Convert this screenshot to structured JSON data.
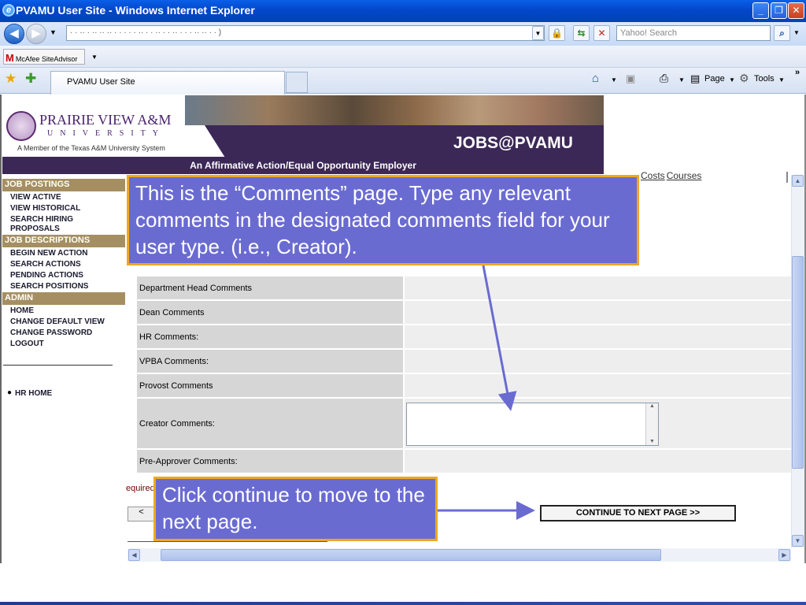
{
  "window": {
    "title": "PVAMU User Site - Windows Internet Explorer",
    "minimize": "_",
    "maximize": "❐",
    "close": "✕"
  },
  "navbar": {
    "address_text": "· · ·· · ·· ·· ·· · · · · · ·· · · ·· · · ·· · · · ·· ·· · · )",
    "search_placeholder": "Yahoo! Search"
  },
  "linksbar": {
    "siteadvisor_mark": "M",
    "siteadvisor_label": "McAfee SiteAdvisor"
  },
  "tabs": {
    "active_label": "PVAMU User Site",
    "page_menu": "Page",
    "tools_menu": "Tools"
  },
  "banner": {
    "university_name": "PRAIRIE VIEW A&M",
    "university_sub": "UNIVERSITY",
    "member_text": "A Member of the Texas A&M University System",
    "jobs_title": "JOBS@PVAMU",
    "aa_text": "An Affirmative Action/Equal Opportunity Employer"
  },
  "sidebar": {
    "job_postings": "JOB POSTINGS",
    "view_active": "VIEW ACTIVE",
    "view_historical": "VIEW HISTORICAL",
    "search_hiring_1": "SEARCH HIRING",
    "search_hiring_2": "PROPOSALS",
    "job_descriptions": "JOB DESCRIPTIONS",
    "begin_new_action": "BEGIN NEW ACTION",
    "search_actions": "SEARCH ACTIONS",
    "pending_actions": "PENDING ACTIONS",
    "search_positions": "SEARCH POSITIONS",
    "admin": "ADMIN",
    "home": "HOME",
    "change_default_view": "CHANGE DEFAULT VIEW",
    "change_password": "CHANGE PASSWORD",
    "logout": "LOGOUT",
    "hr_home": "HR HOME"
  },
  "toplinks": {
    "costs": "Costs",
    "courses": "Courses"
  },
  "comments": {
    "department_head": "Department Head Comments",
    "dean": "Dean Comments",
    "hr": "HR Comments:",
    "vpba": "VPBA Comments:",
    "provost": "Provost Comments",
    "creator": "Creator Comments:",
    "pre_approver": "Pre-Approver Comments:"
  },
  "form": {
    "required_text": "equired",
    "back_label": "<",
    "continue_label": "CONTINUE TO NEXT PAGE >>",
    "creator_value": ""
  },
  "callouts": {
    "comments_text": "This is  the “Comments” page. Type any relevant comments in the designated comments field for your user type. (i.e., Creator).",
    "continue_text": "Click continue to move to the next page."
  },
  "colors": {
    "callout_fill": "#6a6bd1",
    "callout_border": "#f0a81d",
    "brand_purple": "#3b2857",
    "sidebar_gold": "#a58f62"
  }
}
